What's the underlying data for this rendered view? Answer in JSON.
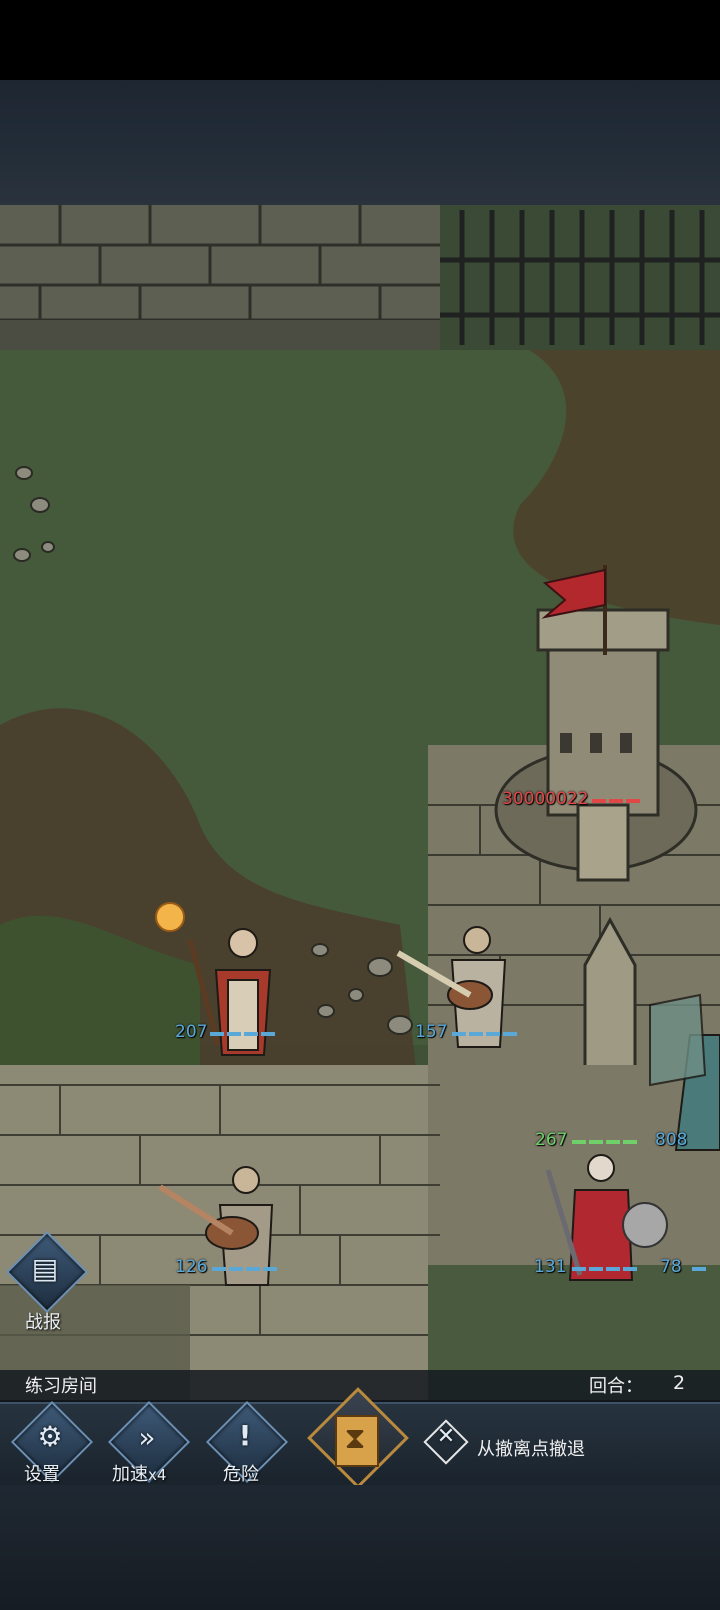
{
  "status": {
    "room_name": "练习房间",
    "round_label": "回合：",
    "round_value": "2"
  },
  "toolbar": {
    "report_label": "战报",
    "settings_label": "设置",
    "speed_label": "加速",
    "speed_multiplier": "x4",
    "danger_label": "危险",
    "retreat_label": "从撤离点撤退"
  },
  "units": {
    "mage_hp": "207",
    "bard_top_hp": "157",
    "bard_bottom_hp": "126",
    "tower_hp": "30000022",
    "obelisk_hp": "267",
    "enemy_priest_hp": "131",
    "enemy_right_hp": "808",
    "enemy_far_hp": "78"
  },
  "colors": {
    "ally": "#5aa8d8",
    "neutral": "#6fd06a",
    "enemy": "#e04848",
    "accent": "#d8a24a"
  }
}
